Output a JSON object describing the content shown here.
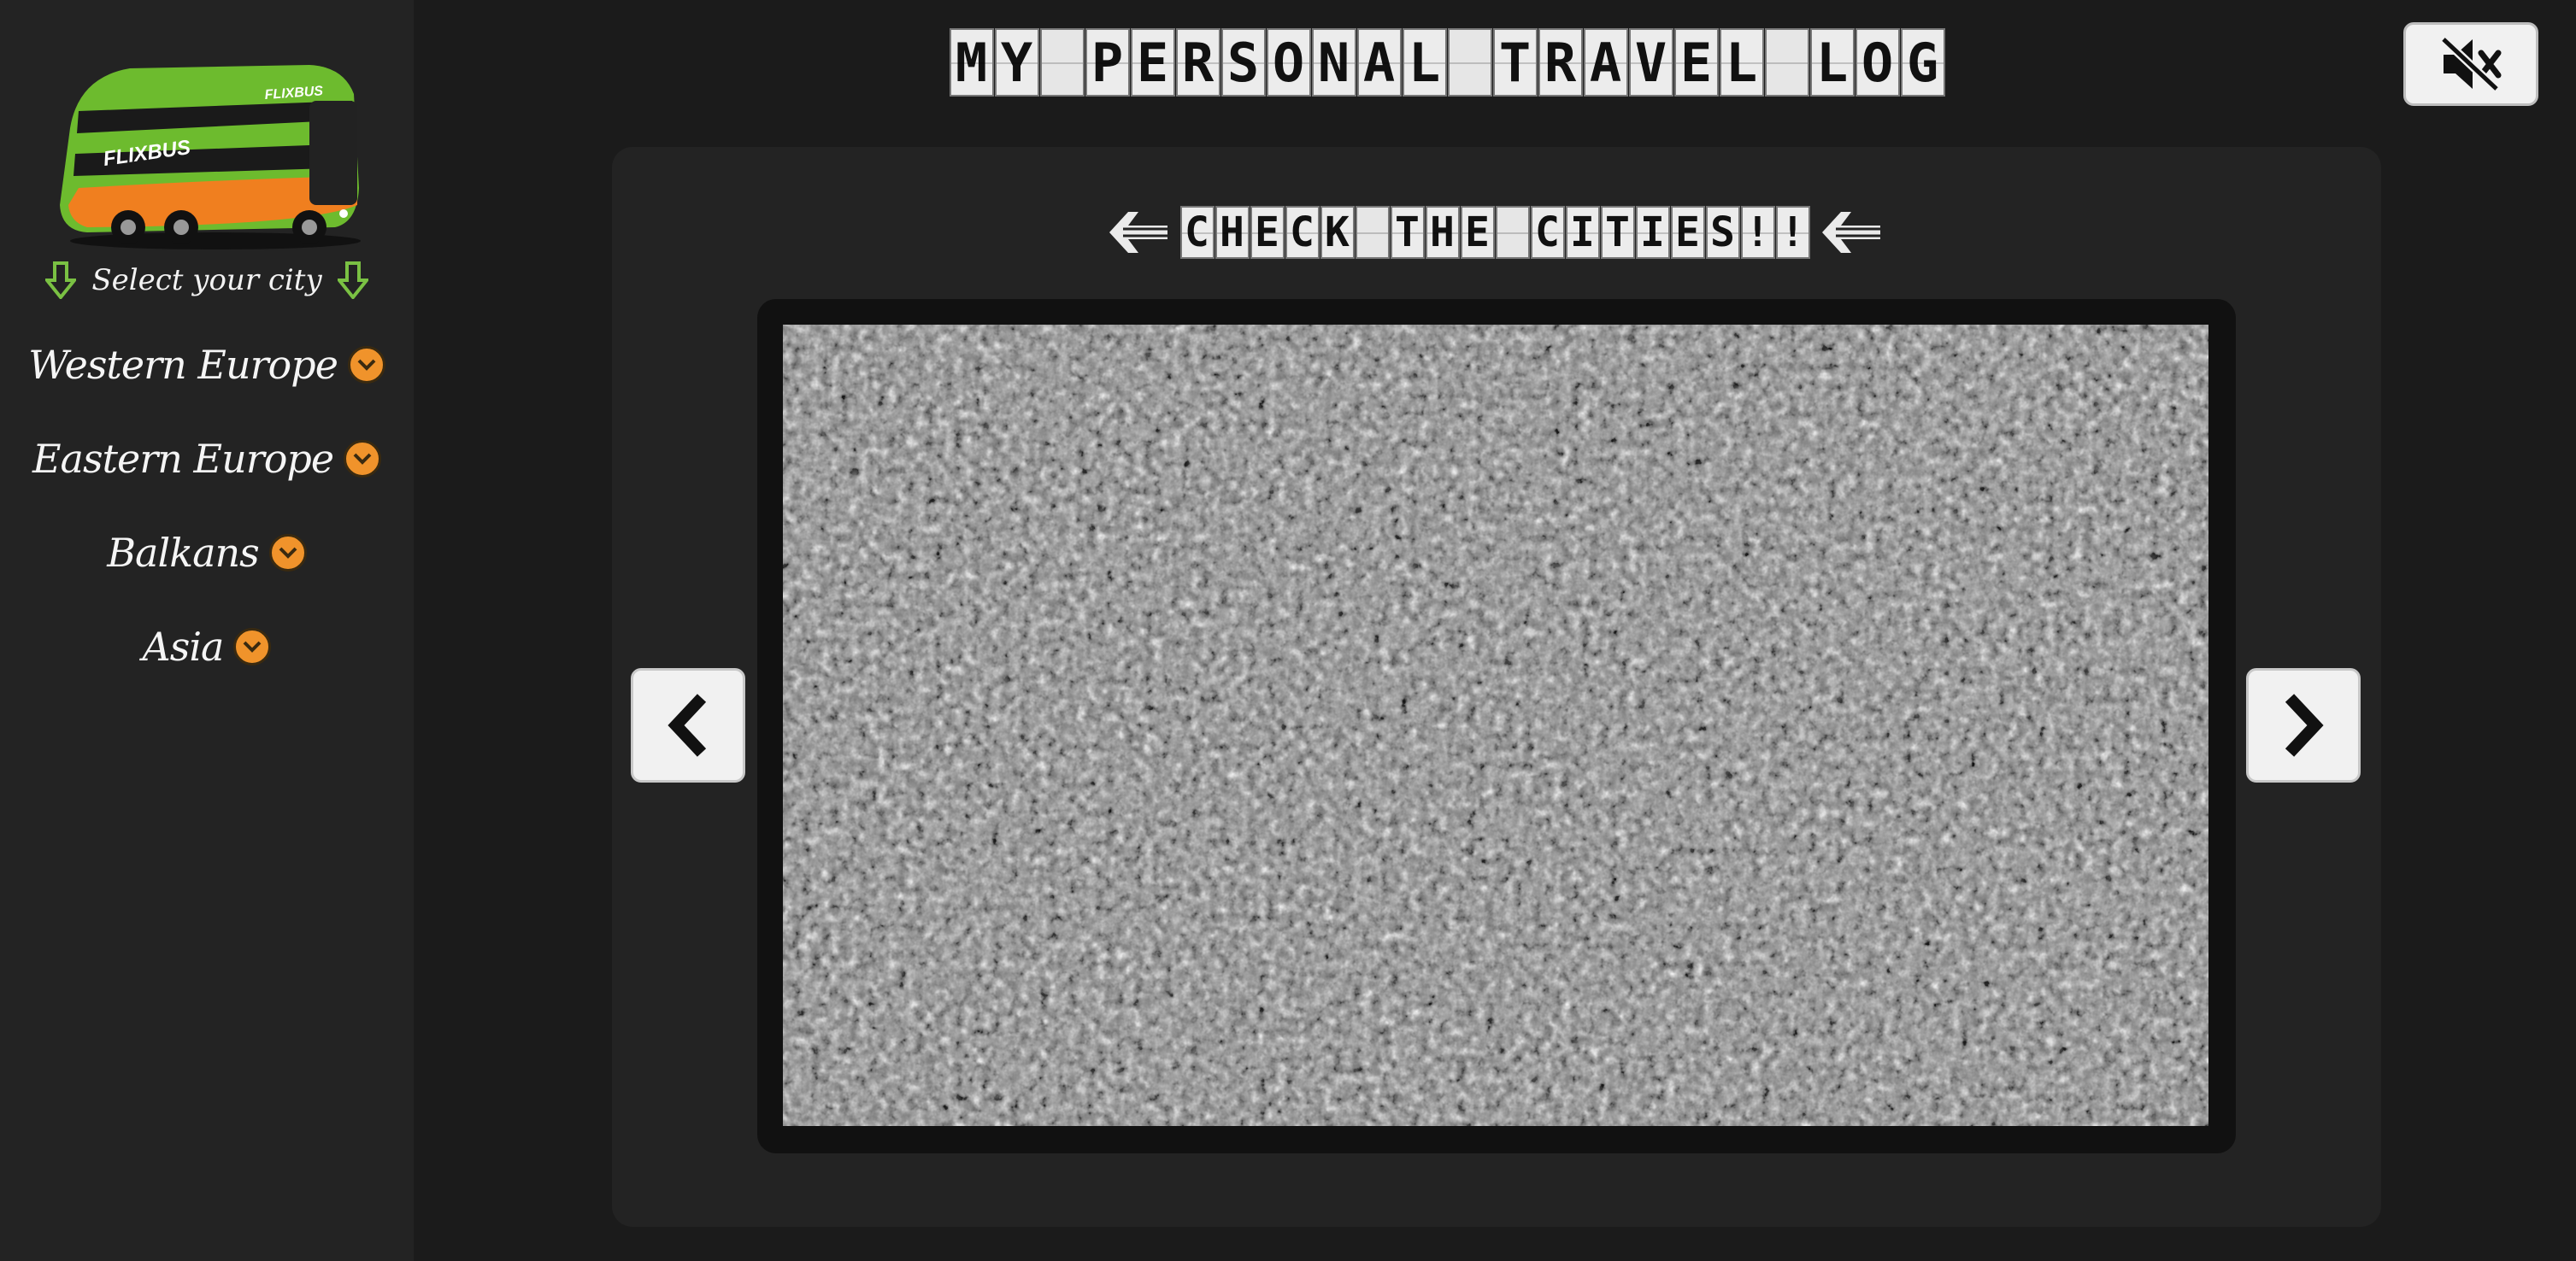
{
  "header": {
    "title_words": [
      "MY",
      "PERSONAL",
      "TRAVEL",
      "LOG"
    ],
    "mute_icon": "volume-mute-icon"
  },
  "sidebar": {
    "logo_text": "FLIXBUS",
    "select_label": "Select your city",
    "regions": [
      {
        "label": "Western Europe",
        "icon": "chevron-down-icon"
      },
      {
        "label": "Eastern Europe",
        "icon": "chevron-down-icon"
      },
      {
        "label": "Balkans",
        "icon": "chevron-down-icon"
      },
      {
        "label": "Asia",
        "icon": "chevron-down-icon"
      }
    ]
  },
  "main": {
    "check_words": [
      "CHECK",
      "THE",
      "CITIES!!"
    ],
    "prev_icon": "chevron-left-icon",
    "next_icon": "chevron-right-icon",
    "screen_content": "tv-static-noise"
  },
  "colors": {
    "background": "#1b1b1b",
    "panel": "#232323",
    "accent_orange": "#f0932b",
    "accent_green": "#7ac143",
    "tile": "#ececec"
  }
}
